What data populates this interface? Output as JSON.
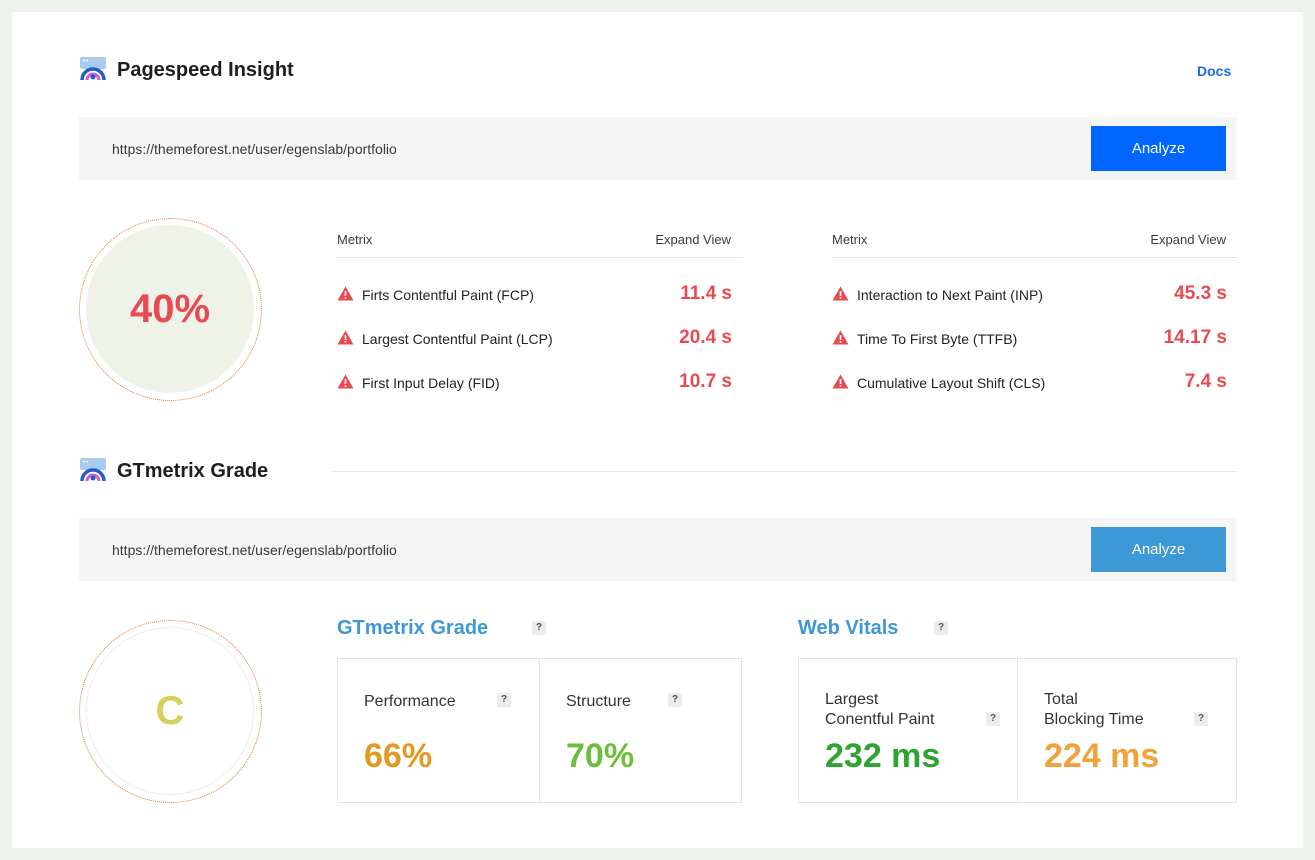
{
  "pagespeed": {
    "title": "Pagespeed Insight",
    "docs_label": "Docs",
    "url": "https://themeforest.net/user/egenslab/portfolio",
    "analyze_label": "Analyze",
    "score": "40%",
    "left_table": {
      "col_metric": "Metrix",
      "col_expand": "Expand View",
      "rows": [
        {
          "label": "Firts Contentful Paint (FCP)",
          "value": "11.4 s"
        },
        {
          "label": "Largest Contentful Paint (LCP)",
          "value": "20.4 s"
        },
        {
          "label": "First Input Delay (FID)",
          "value": "10.7 s"
        }
      ]
    },
    "right_table": {
      "col_metric": "Metrix",
      "col_expand": "Expand View",
      "rows": [
        {
          "label": "Interaction to Next Paint (INP)",
          "value": "45.3 s"
        },
        {
          "label": "Time To First Byte (TTFB)",
          "value": "14.17 s"
        },
        {
          "label": "Cumulative Layout Shift (CLS)",
          "value": "7.4 s"
        }
      ]
    }
  },
  "gtmetrix": {
    "title": "GTmetrix Grade",
    "url": "https://themeforest.net/user/egenslab/portfolio",
    "analyze_label": "Analyze",
    "grade": "C",
    "grade_section": {
      "title": "GTmetrix Grade",
      "help": "?",
      "performance_label": "Performance",
      "performance_value": "66%",
      "structure_label": "Structure",
      "structure_value": "70%"
    },
    "vitals_section": {
      "title": "Web Vitals",
      "help": "?",
      "lcp_label_1": "Largest",
      "lcp_label_2": "Conentful Paint",
      "lcp_value": "232 ms",
      "tbt_label_1": "Total",
      "tbt_label_2": "Blocking Time",
      "tbt_value": "224 ms"
    }
  },
  "colors": {
    "primary_blue": "#0066ff",
    "light_blue": "#3d98d5",
    "danger": "#e94a52",
    "performance": "#e39a22",
    "structure": "#6cbf3a",
    "lcp": "#2fa32f",
    "tbt": "#f1a23a",
    "grade": "#d6d05a"
  }
}
